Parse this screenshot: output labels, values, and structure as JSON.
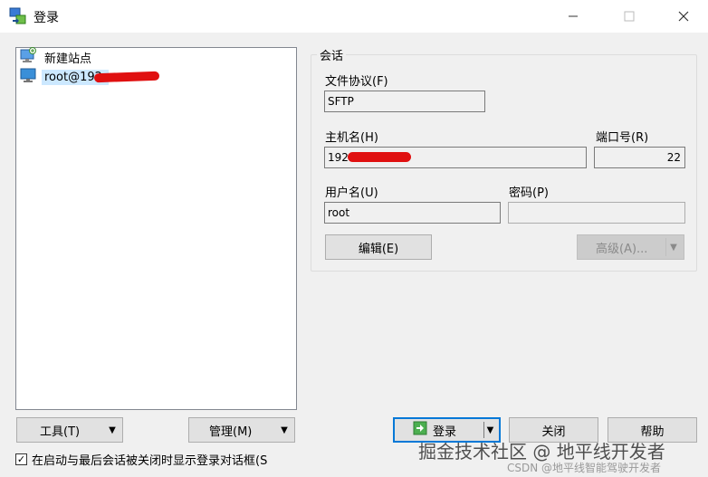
{
  "window": {
    "title": "登录"
  },
  "sites": [
    {
      "label": "新建站点",
      "icon": "new-site-icon"
    },
    {
      "label": "root@192.",
      "icon": "computer-icon",
      "selected": true
    }
  ],
  "session": {
    "group_title": "会话",
    "protocol_label": "文件协议(F)",
    "protocol_value": "SFTP",
    "host_label": "主机名(H)",
    "host_value": "192.",
    "port_label": "端口号(R)",
    "port_value": "22",
    "user_label": "用户名(U)",
    "user_value": "root",
    "password_label": "密码(P)",
    "password_value": "",
    "edit_button": "编辑(E)",
    "advanced_button": "高级(A)..."
  },
  "bottom": {
    "tools_button": "工具(T)",
    "manage_button": "管理(M)",
    "login_button": "登录",
    "close_button": "关闭",
    "help_button": "帮助",
    "checkbox_label": "在启动与最后会话被关闭时显示登录对话框(S",
    "checkbox_checked": true
  },
  "watermark": {
    "line1": "掘金技术社区 @ 地平线开发者",
    "line2": "CSDN @地平线智能驾驶开发者"
  },
  "colors": {
    "accent": "#0078d7",
    "selection": "#cce8ff",
    "redaction": "#e01010"
  }
}
